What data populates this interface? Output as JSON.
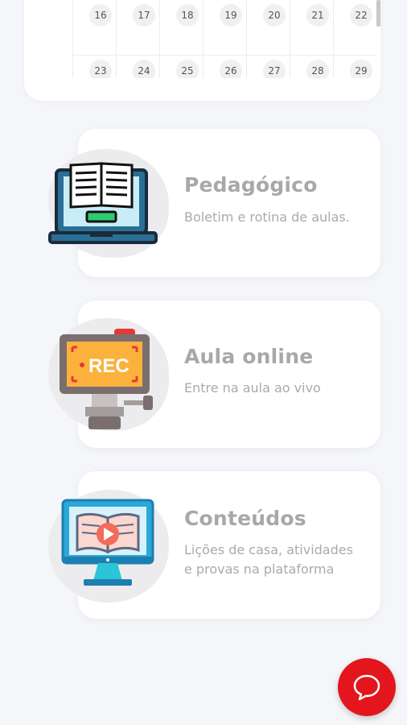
{
  "calendar": {
    "weeks": [
      [
        "16",
        "17",
        "18",
        "19",
        "20",
        "21",
        "22"
      ],
      [
        "23",
        "24",
        "25",
        "26",
        "27",
        "28",
        "29"
      ]
    ]
  },
  "features": [
    {
      "title": "Pedagógico",
      "desc_lines": [
        "Boletim e rotina de aulas."
      ],
      "icon": "laptop-book-icon"
    },
    {
      "title": "Aula online",
      "desc_lines": [
        "Entre na aula ao vivo"
      ],
      "icon": "rec-camera-icon"
    },
    {
      "title": "Conteúdos",
      "desc_lines": [
        "Lições de casa, atividades",
        "e provas na plataforma"
      ],
      "icon": "monitor-video-book-icon"
    }
  ],
  "chat": {
    "icon": "chat-bubble-icon",
    "color": "#e3161d"
  }
}
